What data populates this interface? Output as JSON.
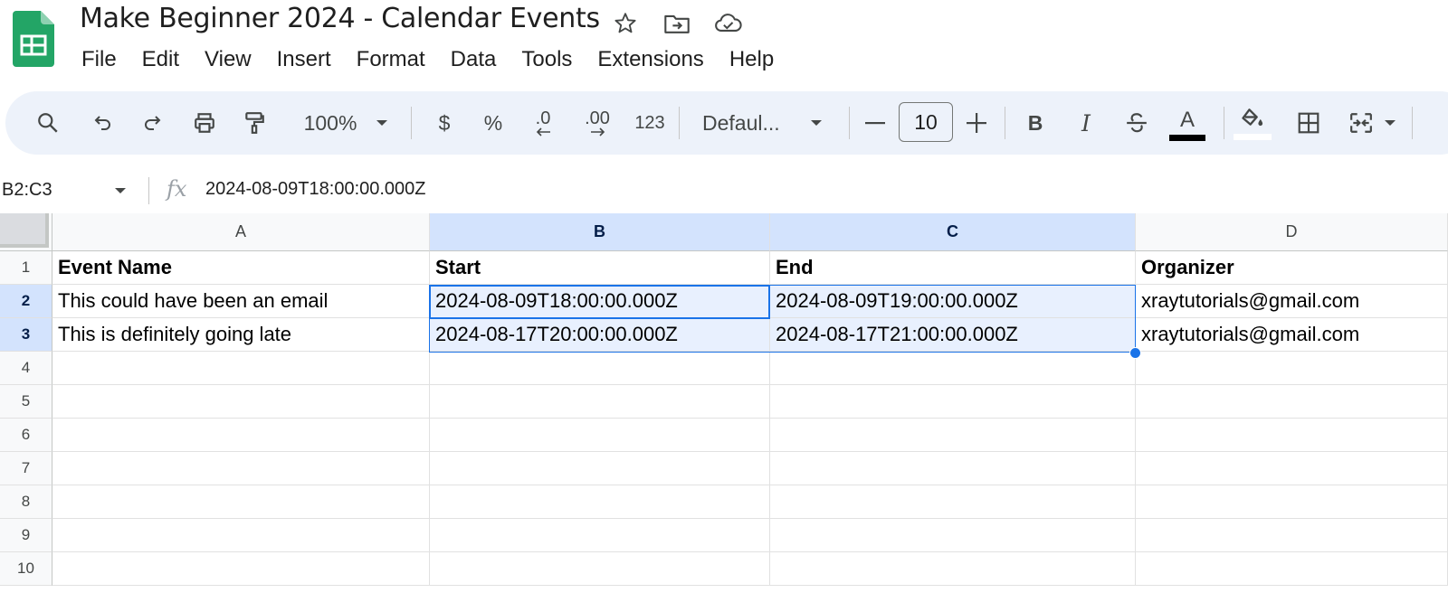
{
  "document": {
    "title": "Make Beginner 2024 - Calendar Events"
  },
  "menu": {
    "items": [
      "File",
      "Edit",
      "View",
      "Insert",
      "Format",
      "Data",
      "Tools",
      "Extensions",
      "Help"
    ]
  },
  "toolbar": {
    "zoom": "100%",
    "currency": "$",
    "percent": "%",
    "decrease_decimal": ".0",
    "increase_decimal": ".00",
    "number_format": "123",
    "font": "Defaul...",
    "font_size": "10",
    "bold": "B",
    "italic": "I",
    "text_color_letter": "A"
  },
  "formula_bar": {
    "name_box": "B2:C3",
    "fx": "fx",
    "content": "2024-08-09T18:00:00.000Z"
  },
  "grid": {
    "columns": [
      "A",
      "B",
      "C",
      "D"
    ],
    "selected_columns": [
      "B",
      "C"
    ],
    "rows": [
      "1",
      "2",
      "3",
      "4",
      "5",
      "6",
      "7",
      "8",
      "9",
      "10"
    ],
    "selected_rows": [
      "2",
      "3"
    ],
    "cells": [
      [
        "Event Name",
        "Start",
        "End",
        "Organizer"
      ],
      [
        "This could have been an email",
        "2024-08-09T18:00:00.000Z",
        "2024-08-09T19:00:00.000Z",
        "xraytutorials@gmail.com"
      ],
      [
        "This is definitely going late",
        "2024-08-17T20:00:00.000Z",
        "2024-08-17T21:00:00.000Z",
        "xraytutorials@gmail.com"
      ]
    ]
  },
  "colors": {
    "sheets_green": "#23a566",
    "toolbar_bg": "#edf2fa",
    "selection_blue": "#1a73e8",
    "selection_fill": "#e8f0fe",
    "header_selected": "#d3e3fd"
  }
}
